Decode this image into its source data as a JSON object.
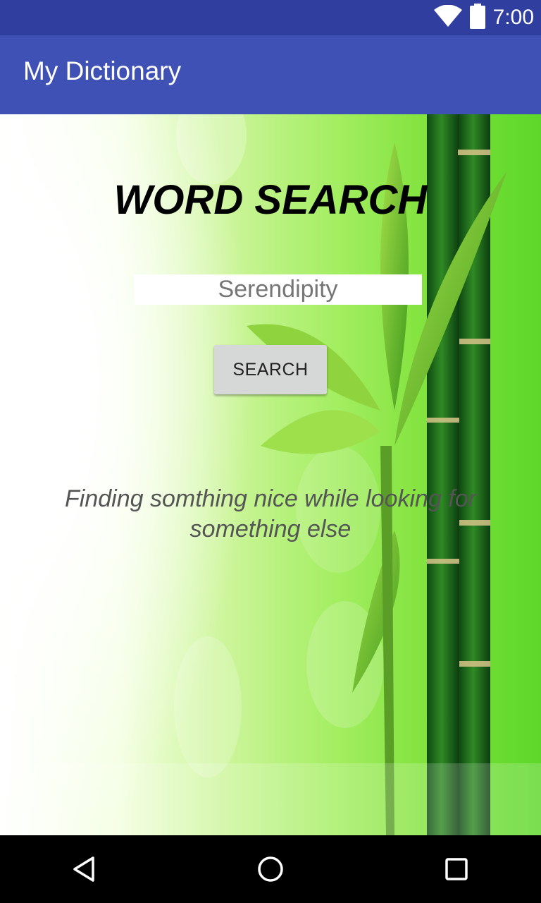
{
  "status_bar": {
    "time": "7:00",
    "icons": [
      "wifi-icon",
      "battery-icon"
    ]
  },
  "app_bar": {
    "title": "My Dictionary"
  },
  "main": {
    "heading": "WORD SEARCH",
    "search_input": {
      "value": "",
      "placeholder": "Serendipity"
    },
    "search_button_label": "SEARCH",
    "definition": "Finding somthing nice while looking for something else"
  },
  "nav_bar": {
    "icons": [
      "back-icon",
      "home-icon",
      "recents-icon"
    ]
  },
  "colors": {
    "status_bar": "#303f9f",
    "app_bar": "#3f51b5",
    "button": "#d6d7d7",
    "background_green": "#7fe23a"
  }
}
